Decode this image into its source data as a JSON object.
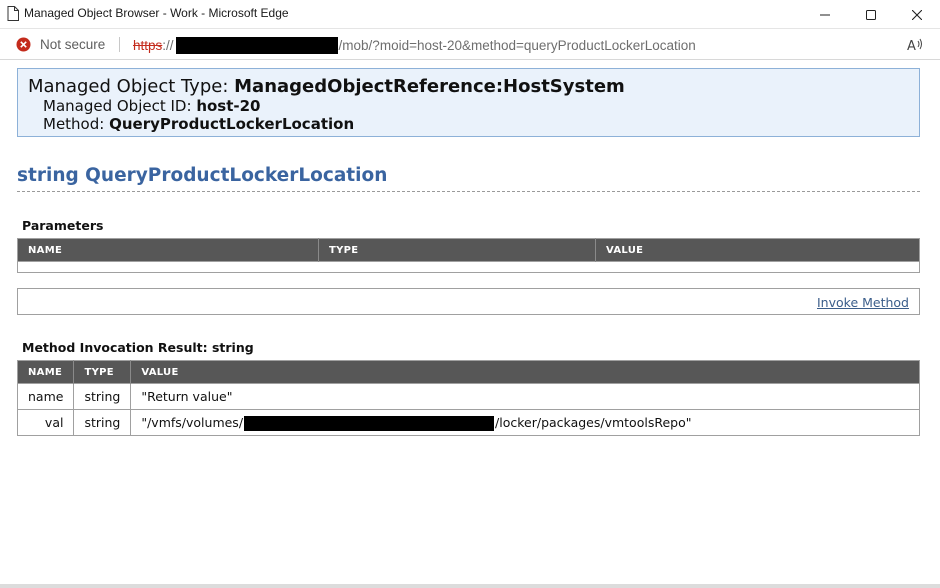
{
  "window": {
    "title": "Managed Object Browser - Work - Microsoft Edge",
    "icons": {
      "page": "page-icon",
      "minimize": "minimize-icon",
      "maximize": "maximize-icon",
      "close": "close-icon"
    }
  },
  "address_bar": {
    "security_label": "Not secure",
    "url_scheme": "https",
    "url_scheme_sep": "://",
    "url_path": "/mob/?moid=host-20&method=queryProductLockerLocation",
    "icons": {
      "security": "error-circle-icon",
      "read_aloud": "read-aloud-icon"
    },
    "colors": {
      "security_error": "#c42b1c"
    }
  },
  "header": {
    "type_label": "Managed Object Type:",
    "type_value": "ManagedObjectReference:HostSystem",
    "id_label": "Managed Object ID:",
    "id_value": "host-20",
    "method_label": "Method:",
    "method_value": "QueryProductLockerLocation"
  },
  "method_signature": "string QueryProductLockerLocation",
  "parameters": {
    "heading": "Parameters",
    "columns": [
      "NAME",
      "TYPE",
      "VALUE"
    ]
  },
  "invoke": {
    "label": "Invoke Method"
  },
  "result": {
    "heading": "Method Invocation Result: string",
    "columns": [
      "NAME",
      "TYPE",
      "VALUE"
    ],
    "rows": [
      {
        "name": "name",
        "type": "string",
        "value": "\"Return value\""
      },
      {
        "name": "val",
        "type": "string",
        "value_prefix": "\"/vmfs/volumes/",
        "value_suffix": "/locker/packages/vmtoolsRepo\""
      }
    ]
  },
  "colors": {
    "header_bg": "#eaf2fb",
    "header_border": "#8db1d8",
    "method_title": "#3a64a0",
    "table_header_bg": "#575757",
    "link": "#3a5d8a"
  }
}
